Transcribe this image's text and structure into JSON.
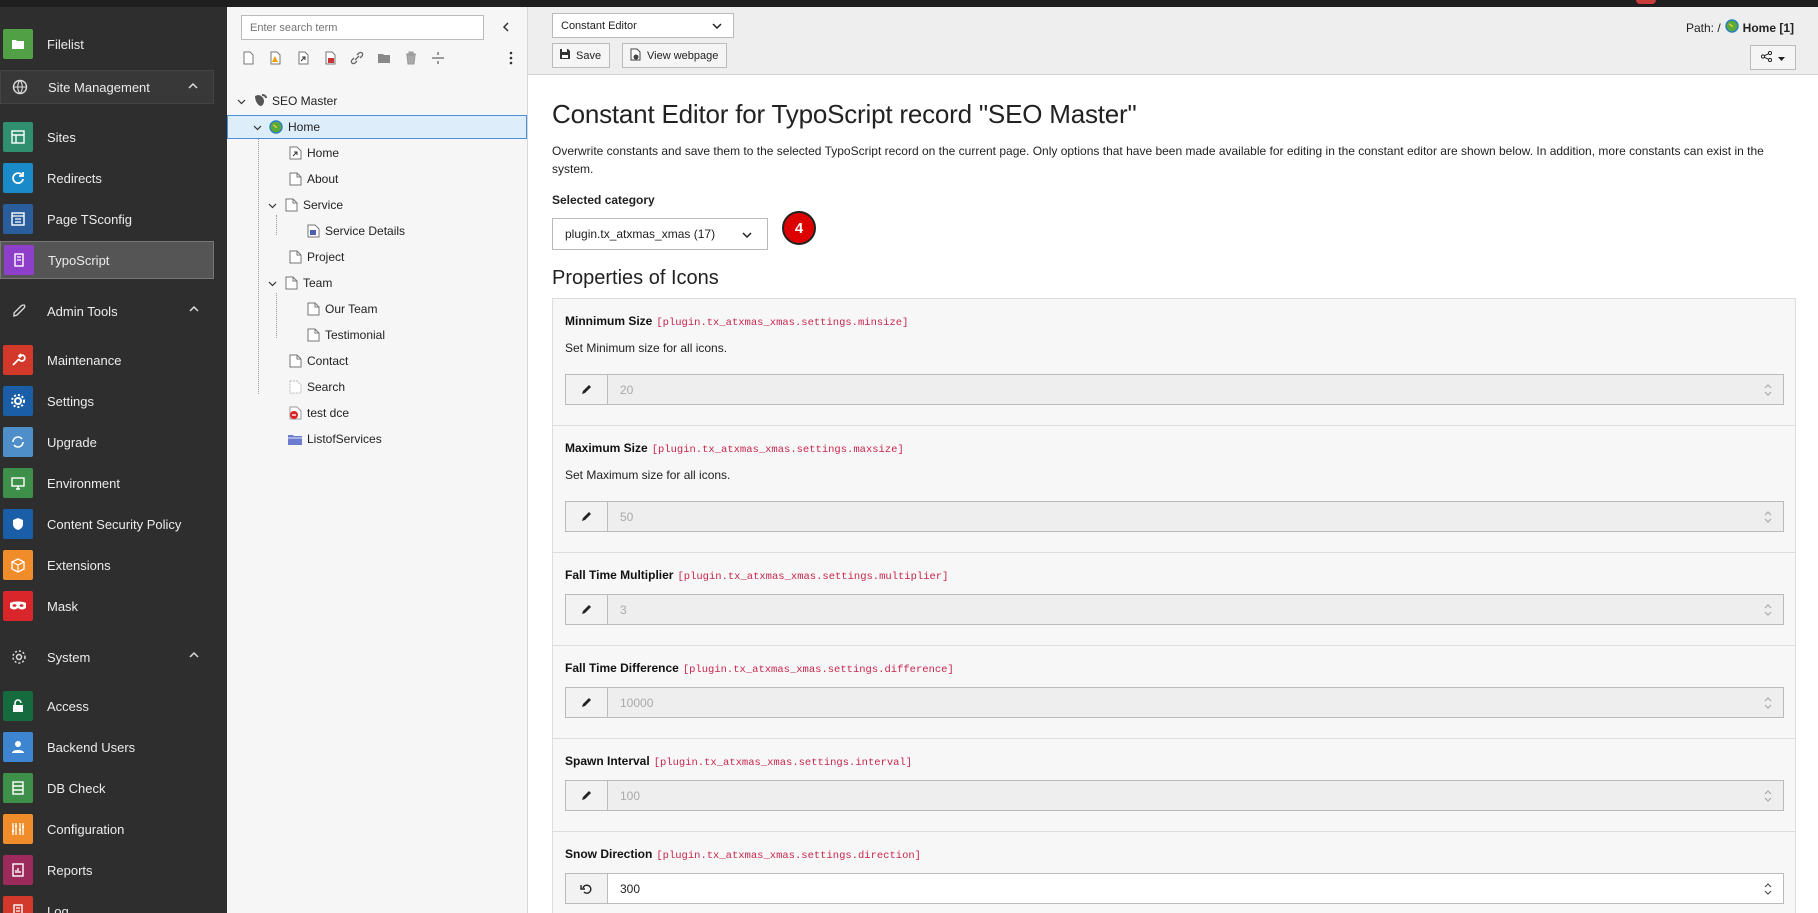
{
  "modules": {
    "filelist": "Filelist",
    "site_management": "Site Management",
    "sites": "Sites",
    "redirects": "Redirects",
    "page_tsconfig": "Page TSconfig",
    "typoscript": "TypoScript",
    "admin_tools": "Admin Tools",
    "maintenance": "Maintenance",
    "settings": "Settings",
    "upgrade": "Upgrade",
    "environment": "Environment",
    "csp": "Content Security Policy",
    "extensions": "Extensions",
    "mask": "Mask",
    "system": "System",
    "access": "Access",
    "backend_users": "Backend Users",
    "db_check": "DB Check",
    "configuration": "Configuration",
    "reports": "Reports",
    "log": "Log"
  },
  "tree": {
    "search_placeholder": "Enter search term",
    "root": "SEO Master",
    "home": "Home",
    "home_child": "Home",
    "about": "About",
    "service": "Service",
    "service_details": "Service Details",
    "project": "Project",
    "team": "Team",
    "our_team": "Our Team",
    "testimonial": "Testimonial",
    "contact": "Contact",
    "search": "Search",
    "test_dce": "test dce",
    "listofservices": "ListofServices"
  },
  "header": {
    "function_select": "Constant Editor",
    "save": "Save",
    "view": "View webpage",
    "path_label": "Path: /",
    "path_page": "Home [1]"
  },
  "content": {
    "title": "Constant Editor for TypoScript record \"SEO Master\"",
    "description": "Overwrite constants and save them to the selected TypoScript record on the current page. Only options that have been made available for editing in the constant editor are shown below. In addition, more constants can exist in the system.",
    "category_label": "Selected category",
    "category_value": "plugin.tx_atxmas_xmas (17)",
    "badge": "4",
    "section_title": "Properties of Icons",
    "props": [
      {
        "name": "Minnimum Size",
        "key": "[plugin.tx_atxmas_xmas.settings.minsize]",
        "desc": "Set Minimum size for all icons.",
        "value": "20"
      },
      {
        "name": "Maximum Size",
        "key": "[plugin.tx_atxmas_xmas.settings.maxsize]",
        "desc": "Set Maximum size for all icons.",
        "value": "50"
      },
      {
        "name": "Fall Time Multiplier",
        "key": "[plugin.tx_atxmas_xmas.settings.multiplier]",
        "desc": "",
        "value": "3"
      },
      {
        "name": "Fall Time Difference",
        "key": "[plugin.tx_atxmas_xmas.settings.difference]",
        "desc": "",
        "value": "10000"
      },
      {
        "name": "Spawn Interval",
        "key": "[plugin.tx_atxmas_xmas.settings.interval]",
        "desc": "",
        "value": "100"
      },
      {
        "name": "Snow Direction",
        "key": "[plugin.tx_atxmas_xmas.settings.direction]",
        "desc": "",
        "value": "300"
      }
    ]
  }
}
